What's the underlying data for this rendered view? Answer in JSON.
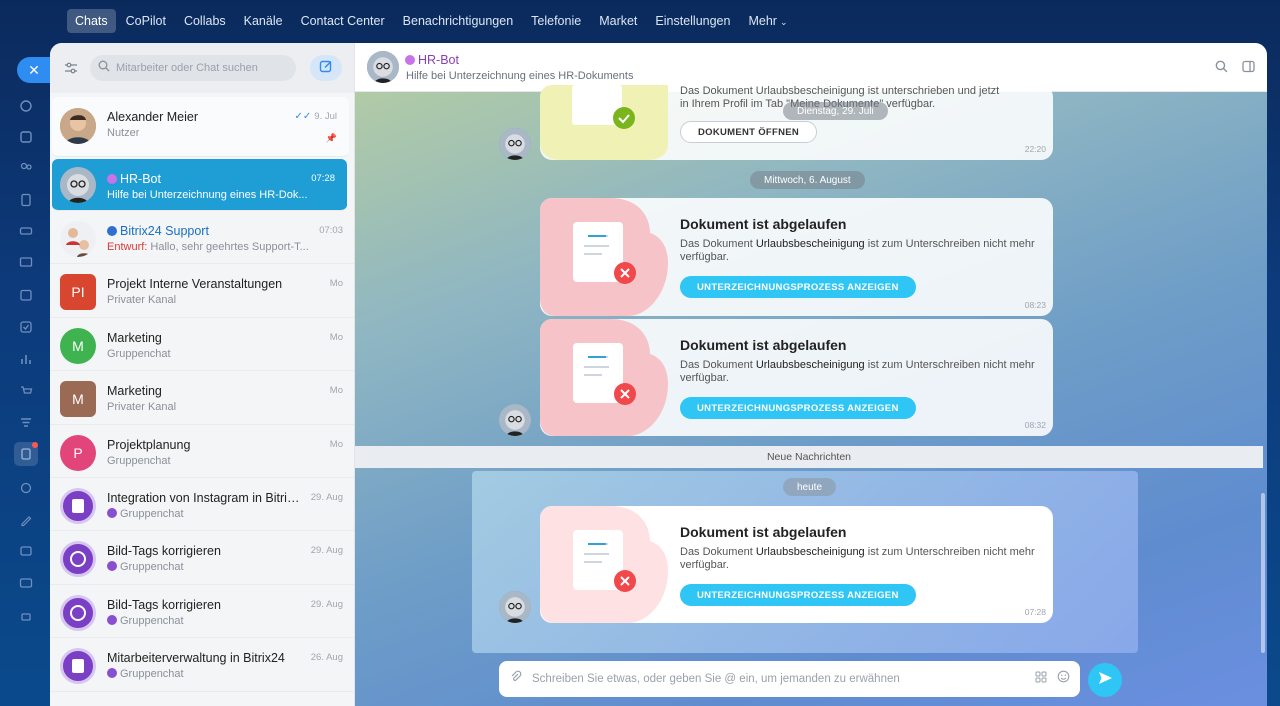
{
  "topnav": {
    "items": [
      "Chats",
      "CoPilot",
      "Collabs",
      "Kanäle",
      "Contact Center",
      "Benachrichtigungen",
      "Telefonie",
      "Market",
      "Einstellungen",
      "Mehr"
    ]
  },
  "sidebar": {
    "search_placeholder": "Mitarbeiter oder Chat suchen",
    "chats": [
      {
        "title": "Alexander Meier",
        "subtitle": "Nutzer",
        "time": "9. Jul"
      },
      {
        "title": "HR-Bot",
        "subtitle": "Hilfe bei Unterzeichnung eines HR-Dok...",
        "time": "07:28"
      },
      {
        "title": "Bitrix24 Support",
        "draft_label": "Entwurf:",
        "subtitle": "Hallo, sehr geehrtes Support-T...",
        "time": "07:03"
      },
      {
        "title": "Projekt Interne Veranstaltungen",
        "subtitle": "Privater Kanal",
        "time": "Mo",
        "initials": "PI"
      },
      {
        "title": "Marketing",
        "subtitle": "Gruppenchat",
        "time": "Mo",
        "initials": "M"
      },
      {
        "title": "Marketing",
        "subtitle": "Privater Kanal",
        "time": "Mo",
        "initials": "M"
      },
      {
        "title": "Projektplanung",
        "subtitle": "Gruppenchat",
        "time": "Mo",
        "initials": "P"
      },
      {
        "title": "Integration von Instagram in Bitrix...",
        "subtitle": "Gruppenchat",
        "time": "29. Aug"
      },
      {
        "title": "Bild-Tags korrigieren",
        "subtitle": "Gruppenchat",
        "time": "29. Aug"
      },
      {
        "title": "Bild-Tags korrigieren",
        "subtitle": "Gruppenchat",
        "time": "29. Aug"
      },
      {
        "title": "Mitarbeiterverwaltung in Bitrix24",
        "subtitle": "Gruppenchat",
        "time": "26. Aug"
      }
    ]
  },
  "header": {
    "title": "HR-Bot",
    "subtitle": "Hilfe bei Unterzeichnung eines HR-Dokuments"
  },
  "messages": {
    "top_card": {
      "text_partial": "Das Dokument Urlaubsbescheinigung ist unterschrieben und jetzt",
      "text_line2": "in Ihrem Profil im Tab \"Meine Dokumente\" verfügbar.",
      "button": "DOKUMENT ÖFFNEN",
      "time": "22:20",
      "date_pill": "Dienstag, 29. Juli"
    },
    "date_pill_aug": "Mittwoch, 6. August",
    "expired_cards": [
      {
        "title": "Dokument ist abgelaufen",
        "pre": "Das Dokument",
        "doc": "Urlaubsbescheinigung",
        "post": "ist zum Unterschreiben nicht mehr verfügbar.",
        "button": "UNTERZEICHNUNGSPROZESS ANZEIGEN",
        "time": "08:23"
      },
      {
        "title": "Dokument ist abgelaufen",
        "pre": "Das Dokument",
        "doc": "Urlaubsbescheinigung",
        "post": "ist zum Unterschreiben nicht mehr verfügbar.",
        "button": "UNTERZEICHNUNGSPROZESS ANZEIGEN",
        "time": "08:32"
      },
      {
        "title": "Dokument ist abgelaufen",
        "pre": "Das Dokument",
        "doc": "Urlaubsbescheinigung",
        "post": "ist zum Unterschreiben nicht mehr verfügbar.",
        "button": "UNTERZEICHNUNGSPROZESS ANZEIGEN",
        "time": "07:28"
      }
    ],
    "new_messages_label": "Neue Nachrichten",
    "today_pill": "heute"
  },
  "composer": {
    "placeholder": "Schreiben Sie etwas, oder geben Sie @ ein, um jemanden zu erwähnen"
  },
  "colors": {
    "accent": "#2fc6f6",
    "selected": "#1e9ed4",
    "bot_name": "#8a3fb0",
    "error": "#f0484b",
    "success": "#7ab51d"
  }
}
